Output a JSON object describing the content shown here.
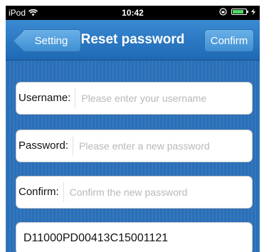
{
  "status_bar": {
    "carrier": "iPod",
    "wifi_icon": "wifi-icon",
    "time": "10:42",
    "lock_icon": "orientation-lock-icon",
    "battery_level": 0.85,
    "battery_color": "#4cd964"
  },
  "nav": {
    "back_label": "Setting",
    "title": "Reset password",
    "confirm_label": "Confirm"
  },
  "form": {
    "username": {
      "label": "Username:",
      "placeholder": "Please enter your username"
    },
    "password": {
      "label": "Password:",
      "placeholder": "Please enter a new password"
    },
    "confirm": {
      "label": "Confirm:",
      "placeholder": "Confirm the new password"
    },
    "device_code": "D11000PD00413C15001121"
  },
  "colors": {
    "nav_blue": "#1f69b4",
    "background_blue": "#2a6fb8"
  }
}
